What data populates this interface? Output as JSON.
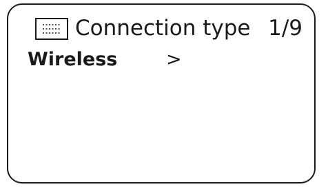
{
  "header": {
    "icon": "menu-list-icon",
    "title": "Connection type",
    "page_counter": "1/9"
  },
  "menu": {
    "items": [
      {
        "label": "Wireless",
        "arrow": ">"
      }
    ]
  }
}
